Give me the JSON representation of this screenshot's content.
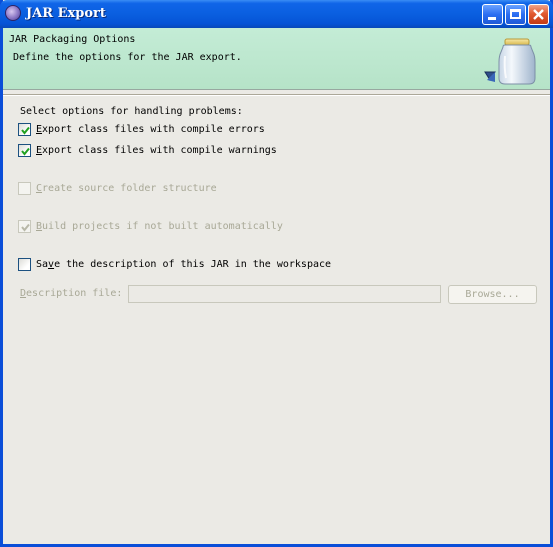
{
  "window": {
    "title": "JAR Export",
    "controls": {
      "minimize": "minimize-button",
      "maximize": "maximize-button",
      "close": "close-button"
    }
  },
  "banner": {
    "title": "JAR Packaging Options",
    "description": "Define the options for the JAR export.",
    "icon": "jar-icon"
  },
  "options": {
    "problems_label": "Select options for handling problems:",
    "compile_errors": {
      "label_first": "E",
      "label_rest": "xport class files with compile errors",
      "checked": true,
      "enabled": true
    },
    "compile_warnings": {
      "label_first": "E",
      "label_rest": "xport class files with compile warnings",
      "checked": true,
      "enabled": true
    },
    "source_folder": {
      "label_first": "C",
      "label_rest": "reate source folder structure",
      "checked": false,
      "enabled": false
    },
    "build_projects": {
      "label_first": "B",
      "label_rest": "uild projects if not built automatically",
      "checked": true,
      "enabled": false
    },
    "save_description": {
      "label_pre": "Sa",
      "label_ul": "v",
      "label_rest": "e the description of this JAR in the workspace",
      "checked": false,
      "enabled": true
    }
  },
  "description_file": {
    "label_first": "D",
    "label_rest": "escription file:",
    "value": "",
    "browse_label": "Browse..."
  },
  "colors": {
    "titlebar": "#0a5fe0",
    "banner": "#c4ecd6",
    "dialog_bg": "#ebeae5",
    "disabled_text": "#a8a896",
    "check_mark": "#21a121"
  }
}
